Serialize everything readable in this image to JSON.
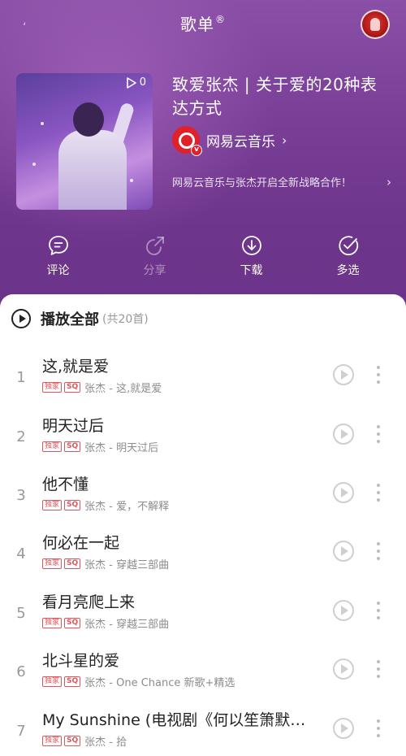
{
  "nav": {
    "title": "歌单",
    "title_mark": "®"
  },
  "playlist": {
    "title": "致爱张杰 | 关于爱的20种表达方式",
    "play_count": "0",
    "creator": {
      "name": "网易云音乐",
      "verified_badge": "v"
    },
    "description": "网易云音乐与张杰开启全新战略合作！",
    "chevron": "›"
  },
  "actions": [
    {
      "label": "评论",
      "icon": "comment-icon",
      "enabled": true
    },
    {
      "label": "分享",
      "icon": "share-icon",
      "enabled": false
    },
    {
      "label": "下载",
      "icon": "download-icon",
      "enabled": true
    },
    {
      "label": "多选",
      "icon": "multi-select-icon",
      "enabled": true
    }
  ],
  "play_all": {
    "label": "播放全部",
    "count": "(共20首)"
  },
  "songs": [
    {
      "index": "1",
      "title": "这,就是爱",
      "tags": [
        "独家",
        "SQ"
      ],
      "subtitle": "张杰 - 这,就是爱"
    },
    {
      "index": "2",
      "title": "明天过后",
      "tags": [
        "独家",
        "SQ"
      ],
      "subtitle": "张杰 - 明天过后"
    },
    {
      "index": "3",
      "title": "他不懂",
      "tags": [
        "独家",
        "SQ"
      ],
      "subtitle": "张杰 - 爱，不解释"
    },
    {
      "index": "4",
      "title": "何必在一起",
      "tags": [
        "独家",
        "SQ"
      ],
      "subtitle": "张杰 - 穿越三部曲"
    },
    {
      "index": "5",
      "title": "看月亮爬上来",
      "tags": [
        "独家",
        "SQ"
      ],
      "subtitle": "张杰 - 穿越三部曲"
    },
    {
      "index": "6",
      "title": "北斗星的爱",
      "tags": [
        "独家",
        "SQ"
      ],
      "subtitle": "张杰 - One Chance 新歌+精选"
    },
    {
      "index": "7",
      "title": "My Sunshine (电视剧《何以笙箫默》…",
      "tags": [
        "独家",
        "SQ"
      ],
      "subtitle": "张杰 - 拾"
    }
  ],
  "colors": {
    "header_top": "#8a4fa6",
    "header_bottom": "#6b3388",
    "tag_red": "#e0545a",
    "brand_red": "#e0202a"
  }
}
